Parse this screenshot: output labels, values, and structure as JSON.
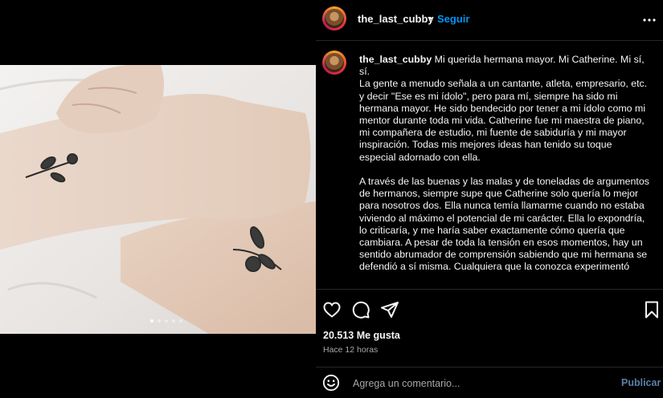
{
  "header": {
    "username": "the_last_cubby",
    "separator": "•",
    "follow_label": "Seguir"
  },
  "caption": {
    "username": "the_last_cubby",
    "text": " Mi querida hermana mayor. Mi Catherine. Mi sí, sí.\nLa gente a menudo señala a un cantante, atleta, empresario, etc. y decir \"Ese es mi ídolo\", pero para mí, siempre ha sido mi hermana mayor. He sido bendecido por tener a mi ídolo como mi mentor durante toda mi vida. Catherine fue mi maestra de piano, mi compañera de estudio, mi fuente de sabiduría y mi mayor inspiración. Todas mis mejores ideas han tenido su toque especial adornado con ella.\n\nA través de las buenas y las malas y de toneladas de argumentos de hermanos, siempre supe que Catherine solo quería lo mejor para nosotros dos. Ella nunca temía llamarme cuando no estaba viviendo al máximo el potencial de mi carácter. Ella lo expondría, lo criticaría, y me haría saber exactamente cómo quería que cambiara. A pesar de toda la tensión en esos momentos, hay un sentido abrumador de comprensión sabiendo que mi hermana se defendió a sí misma. Cualquiera que la conozca experimentó"
  },
  "carousel": {
    "count": 5,
    "active": 0
  },
  "stats": {
    "likes": "20.513 Me gusta",
    "time": "Hace 12 horas"
  },
  "comment": {
    "placeholder": "Agrega un comentario...",
    "post_label": "Publicar"
  },
  "icons": {
    "like": "heart-icon",
    "comment": "comment-icon",
    "share": "share-icon",
    "save": "bookmark-icon",
    "more": "more-icon",
    "emoji": "emoji-icon"
  },
  "colors": {
    "background": "#000000",
    "text": "#f5f5f5",
    "muted": "#a8a8a8",
    "accent": "#0095f6",
    "post_disabled": "#5b7fa8",
    "divider": "#262626"
  }
}
